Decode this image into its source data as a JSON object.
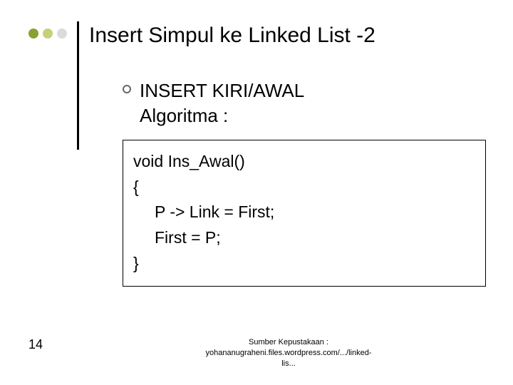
{
  "decor": {
    "dot_colors": [
      "#8aa034",
      "#c4d07a",
      "#dbdbdb"
    ]
  },
  "title": "Insert Simpul ke Linked List -2",
  "section": {
    "line1": "INSERT KIRI/AWAL",
    "line2": "Algoritma :"
  },
  "code": {
    "l1": "void Ins_Awal()",
    "l2": "{",
    "l3": "P -> Link = First;",
    "l4": "First = P;",
    "l5": "}"
  },
  "footer": {
    "page": "14",
    "source_l1": "Sumber Kepustakaan :",
    "source_l2": "yohananugraheni.files.wordpress.com/.../linked-",
    "source_l3": "lis..."
  }
}
